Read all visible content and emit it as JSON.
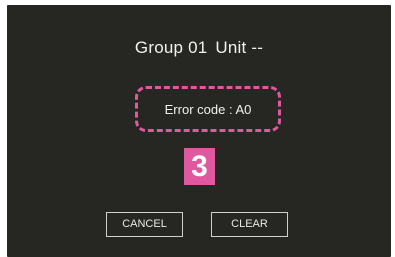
{
  "header": {
    "group": "Group 01",
    "unit": "Unit --"
  },
  "error": {
    "text": "Error code : A0"
  },
  "step_badge": "3",
  "buttons": {
    "cancel": "CANCEL",
    "clear": "CLEAR"
  },
  "colors": {
    "background": "#262623",
    "highlight": "#e0589d",
    "text": "#f1f1ef"
  }
}
